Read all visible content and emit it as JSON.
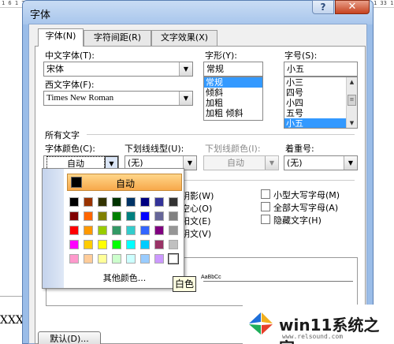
{
  "background": {
    "ruler_left": "1 6 1 7",
    "ruler_right": "1 33 1",
    "doc_text": "XXX"
  },
  "dialog": {
    "title": "字体",
    "help_label": "?",
    "close_label": "✕"
  },
  "tabs": [
    {
      "label": "字体(N)",
      "active": true
    },
    {
      "label": "字符间距(R)",
      "active": false
    },
    {
      "label": "文字效果(X)",
      "active": false
    }
  ],
  "font": {
    "chinese_font_label": "中文字体(T):",
    "chinese_font_value": "宋体",
    "western_font_label": "西文字体(F):",
    "western_font_value": "Times New Roman",
    "style_label": "字形(Y):",
    "style_value": "常规",
    "style_options": [
      "常规",
      "倾斜",
      "加粗",
      "加粗 倾斜"
    ],
    "size_label": "字号(S):",
    "size_value": "小五",
    "size_options": [
      "小三",
      "四号",
      "小四",
      "五号",
      "小五"
    ]
  },
  "all_text": {
    "section_label": "所有文字",
    "color_label": "字体颜色(C):",
    "color_value": "自动",
    "underline_style_label": "下划线线型(U):",
    "underline_style_value": "(无)",
    "underline_color_label": "下划线颜色(I):",
    "underline_color_value": "自动",
    "emphasis_label": "着重号:",
    "emphasis_value": "(无)"
  },
  "effects": {
    "left": [
      "阴影(W)",
      "空心(O)",
      "阳文(E)",
      "阴文(V)"
    ],
    "right": [
      "小型大写字母(M)",
      "全部大写字母(A)",
      "隐藏文字(H)"
    ]
  },
  "palette": {
    "auto_label": "自动",
    "more_colors_label": "其他颜色...",
    "tooltip": "白色",
    "rows": [
      [
        "#000000",
        "#993300",
        "#333300",
        "#003300",
        "#003366",
        "#000080",
        "#333399",
        "#333333"
      ],
      [
        "#800000",
        "#FF6600",
        "#808000",
        "#008000",
        "#008080",
        "#0000FF",
        "#666699",
        "#808080"
      ],
      [
        "#FF0000",
        "#FF9900",
        "#99CC00",
        "#339966",
        "#33CCCC",
        "#3366FF",
        "#800080",
        "#969696"
      ],
      [
        "#FF00FF",
        "#FFCC00",
        "#FFFF00",
        "#00FF00",
        "#00FFFF",
        "#00CCFF",
        "#993366",
        "#C0C0C0"
      ],
      [
        "#FF99CC",
        "#FFCC99",
        "#FFFF99",
        "#CCFFCC",
        "#CCFFFF",
        "#99CCFF",
        "#CC99FF",
        "#FFFFFF"
      ]
    ],
    "selected": "#FFFFFF"
  },
  "preview": {
    "sample_text": "AaBbCc"
  },
  "footer": {
    "default_button": "默认(D)..."
  },
  "watermark": {
    "text": "win11系统之家",
    "url": "www.relsound.com"
  }
}
